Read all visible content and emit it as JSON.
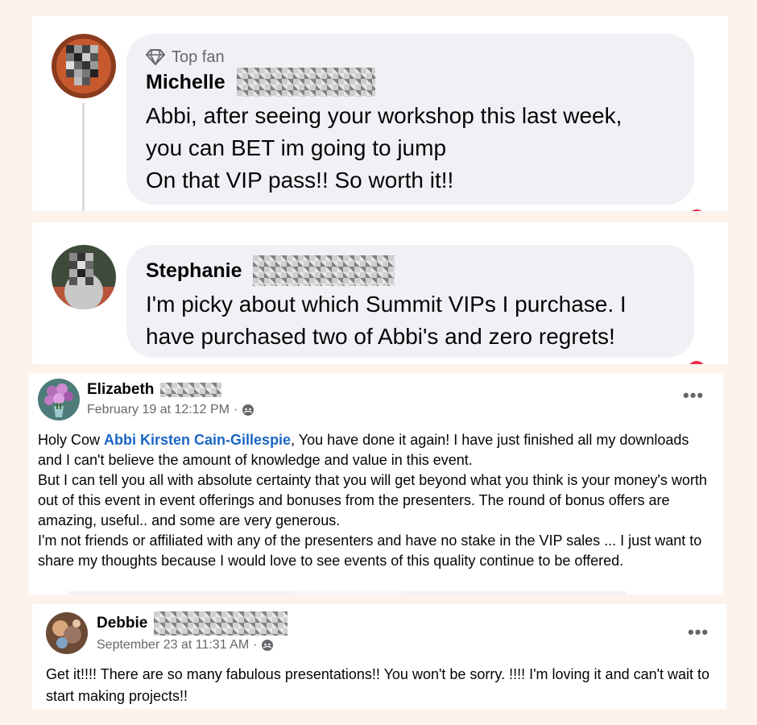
{
  "comments": [
    {
      "badge_label": "Top fan",
      "first_name": "Michelle",
      "lines": [
        "Abbi, after seeing your workshop this last week,",
        "you can BET im going to jump",
        "On that VIP pass!! So worth it!!"
      ]
    },
    {
      "first_name": "Stephanie",
      "lines": [
        "I'm picky about which Summit VIPs I purchase. I",
        "have purchased two of Abbi's and zero regrets!"
      ]
    }
  ],
  "posts": [
    {
      "first_name": "Elizabeth",
      "date": "February 19 at 12:12 PM",
      "paragraphs": [
        {
          "before": "Holy Cow ",
          "mention": "Abbi Kirsten Cain-Gillespie",
          "after": ", You have done it again! I have just finished all my downloads and I can't believe the amount of knowledge and value in this event."
        },
        {
          "text": "But I can tell you all with absolute certainty that you will get beyond what you think is your money's worth out of this event in event offerings and bonuses from the presenters. The round of bonus offers are amazing, useful.. and some are very generous."
        },
        {
          "text": "I'm not friends or affiliated with any of the presenters and have no stake in the VIP sales ... I just want to share my thoughts because I would love to see events of this quality continue to be offered."
        }
      ]
    },
    {
      "first_name": "Debbie",
      "date": "September 23 at 11:31 AM",
      "paragraphs": [
        {
          "text": "Get it!!!!  There are so many fabulous presentations!!  You won't be sorry. !!!!  I'm loving it and can't wait to start making projects!!"
        }
      ]
    }
  ],
  "icons": {
    "badge": "diamond-icon",
    "audience": "globe-icon",
    "menu": "more-options-icon"
  },
  "colors": {
    "page_background": "#fdf3ec",
    "bubble": "#eff1f5",
    "mention": "#1a66c4",
    "meta_text": "#65676b"
  }
}
